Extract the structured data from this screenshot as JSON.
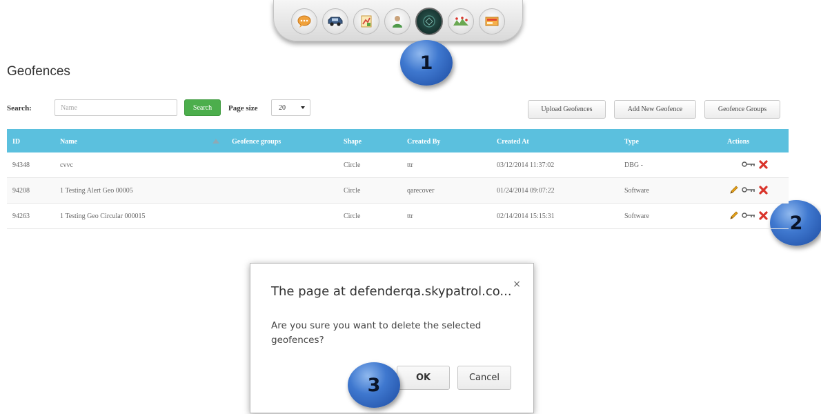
{
  "toolbar": {
    "icons": [
      "chat-icon",
      "vehicle-icon",
      "report-icon",
      "user-icon",
      "geofence-icon",
      "landmark-icon",
      "map-icon"
    ],
    "active": "geofence-icon"
  },
  "callouts": [
    "1",
    "2",
    "3"
  ],
  "page": {
    "title": "Geofences"
  },
  "search": {
    "label": "Search:",
    "placeholder": "Name",
    "button": "Search",
    "page_size_label": "Page size",
    "page_size_value": "20"
  },
  "header_buttons": {
    "upload": "Upload Geofences",
    "add": "Add New Geofence",
    "groups": "Geofence Groups"
  },
  "table": {
    "columns": [
      "ID",
      "Name",
      "Geofence groups",
      "Shape",
      "Created By",
      "Created At",
      "Type",
      "Actions"
    ],
    "rows": [
      {
        "id": "94348",
        "name": "cvvc",
        "groups": "",
        "shape": "Circle",
        "created_by": "ttr",
        "created_at": "03/12/2014 11:37:02",
        "type": "DBG -",
        "actions": [
          "link-icon",
          "delete-icon"
        ]
      },
      {
        "id": "94208",
        "name": "1 Testing Alert Geo 00005",
        "groups": "",
        "shape": "Circle",
        "created_by": "qarecover",
        "created_at": "01/24/2014 09:07:22",
        "type": "Software",
        "actions": [
          "edit-icon",
          "link-icon",
          "delete-icon"
        ]
      },
      {
        "id": "94263",
        "name": "1 Testing Geo Circular 000015",
        "groups": "",
        "shape": "Circle",
        "created_by": "ttr",
        "created_at": "02/14/2014 15:15:31",
        "type": "Software",
        "actions": [
          "edit-icon",
          "link-icon",
          "delete-icon"
        ]
      }
    ]
  },
  "dialog": {
    "title": "The page at defenderqa.skypatrol.co...",
    "close": "×",
    "message": "Are you sure you want to delete the selected geofences?",
    "ok": "OK",
    "cancel": "Cancel"
  },
  "colors": {
    "header_blue": "#5bc0de",
    "search_green": "#4cae4c",
    "callout_blue": "#3f78cf",
    "delete_red": "#d9342b",
    "edit_orange": "#e8a317"
  }
}
